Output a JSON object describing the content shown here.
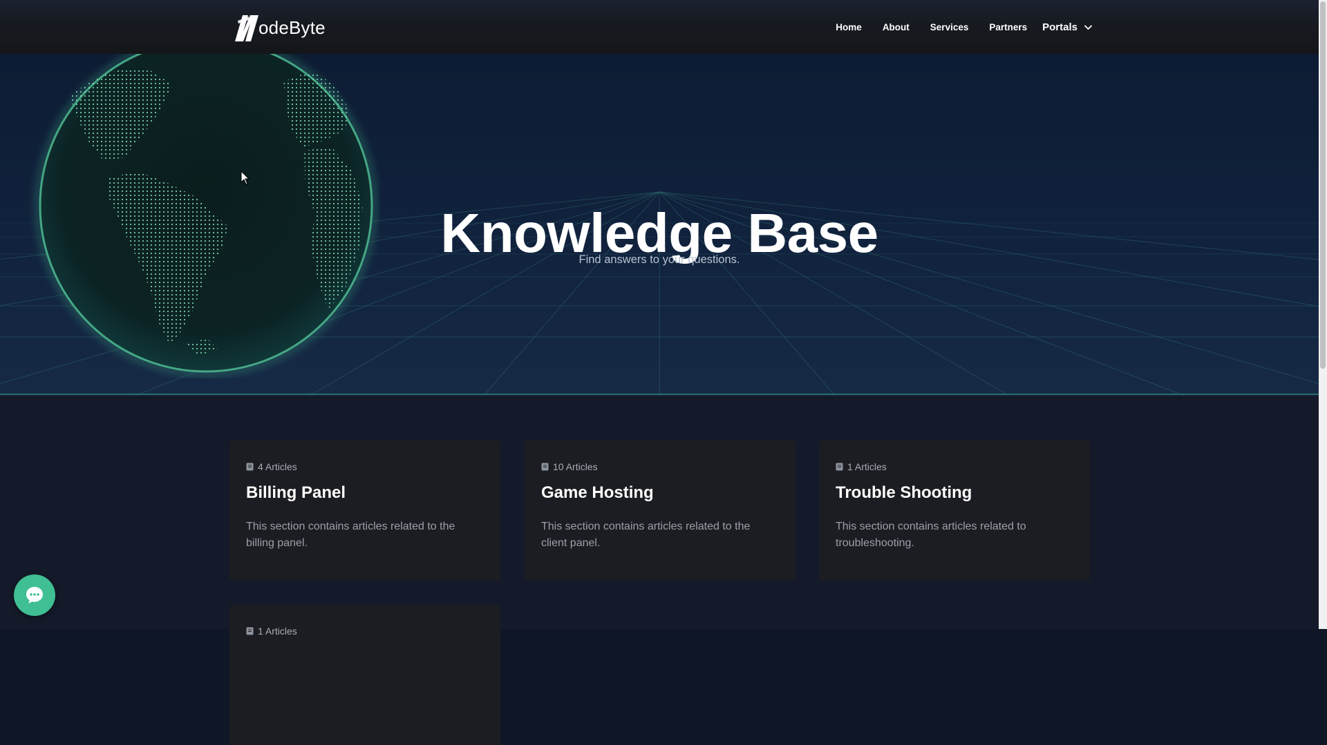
{
  "brand": {
    "logo_text": "odeByte",
    "logo_letter": "N"
  },
  "nav": {
    "links": [
      "Home",
      "About",
      "Services",
      "Partners"
    ],
    "portals_label": "Portals"
  },
  "hero": {
    "title": "Knowledge Base",
    "subtitle": "Find answers to your questions."
  },
  "categories": [
    {
      "count_label": "4 Articles",
      "title": "Billing Panel",
      "description": "This section contains articles related to the billing panel."
    },
    {
      "count_label": "10 Articles",
      "title": "Game Hosting",
      "description": "This section contains articles related to the client panel."
    },
    {
      "count_label": "1 Articles",
      "title": "Trouble Shooting",
      "description": "This section contains articles related to troubleshooting."
    },
    {
      "count_label": "1 Articles",
      "title": "",
      "description": ""
    }
  ],
  "icons": {
    "article": "book-icon",
    "chat": "chat-bubble-icon",
    "dropdown": "chevron-down-icon"
  },
  "colors": {
    "accent": "#3fbf93",
    "hero_bg": "#11223d",
    "card_bg": "#1c1d22",
    "page_bg": "#141a29"
  }
}
